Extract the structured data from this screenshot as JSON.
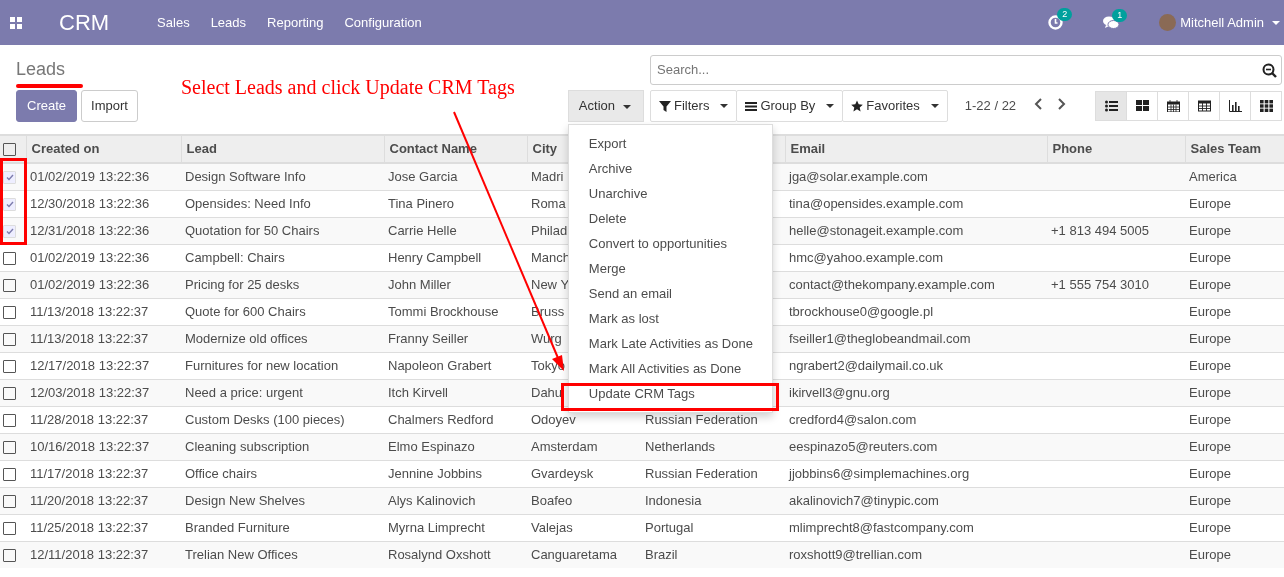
{
  "navbar": {
    "app": "CRM",
    "menu": [
      "Sales",
      "Leads",
      "Reporting",
      "Configuration"
    ],
    "activity_count": "2",
    "message_count": "1",
    "user": "Mitchell Admin"
  },
  "breadcrumb": "Leads",
  "buttons": {
    "create": "Create",
    "import": "Import",
    "action": "Action"
  },
  "search": {
    "placeholder": "Search..."
  },
  "search_options": [
    {
      "kind": "filter",
      "label": "Filters"
    },
    {
      "kind": "group",
      "label": "Group By"
    },
    {
      "kind": "favorite",
      "label": "Favorites"
    }
  ],
  "pager": "1-22 / 22",
  "views": [
    {
      "kind": "list",
      "selected": true
    },
    {
      "kind": "kanban",
      "selected": false
    },
    {
      "kind": "calendar",
      "selected": false
    },
    {
      "kind": "pivot",
      "selected": false
    },
    {
      "kind": "graph",
      "selected": false
    },
    {
      "kind": "dashboard",
      "selected": false
    }
  ],
  "action_menu": {
    "items": [
      "Export",
      "Archive",
      "Unarchive",
      "Delete",
      "Convert to opportunities",
      "Merge",
      "Send an email",
      "Mark as lost",
      "Mark Late Activities as Done",
      "Mark All Activities as Done",
      "Update CRM Tags"
    ]
  },
  "table": {
    "all_selected": false,
    "columns": [
      "Created on",
      "Lead",
      "Contact Name",
      "City",
      null,
      "Email",
      "Phone",
      "Sales Team"
    ],
    "rows": [
      {
        "selected": true,
        "cells": [
          "01/02/2019 13:22:36",
          "Design Software Info",
          "Jose Garcia",
          "Madri",
          null,
          "jga@solar.example.com",
          null,
          "America"
        ]
      },
      {
        "selected": true,
        "cells": [
          "12/30/2018 13:22:36",
          "Opensides: Need Info",
          "Tina Pinero",
          "Roma",
          null,
          "tina@opensides.example.com",
          null,
          "Europe"
        ]
      },
      {
        "selected": true,
        "cells": [
          "12/31/2018 13:22:36",
          "Quotation for 50 Chairs",
          "Carrie Helle",
          "Philad",
          null,
          "helle@stonageit.example.com",
          "+1 813 494 5005",
          "Europe"
        ]
      },
      {
        "selected": false,
        "cells": [
          "01/02/2019 13:22:36",
          "Campbell: Chairs",
          "Henry Campbell",
          "Manch",
          null,
          "hmc@yahoo.example.com",
          null,
          "Europe"
        ]
      },
      {
        "selected": false,
        "cells": [
          "01/02/2019 13:22:36",
          "Pricing for 25 desks",
          "John Miller",
          "New Y",
          null,
          "contact@thekompany.example.com",
          "+1 555 754 3010",
          "Europe"
        ]
      },
      {
        "selected": false,
        "cells": [
          "11/13/2018 13:22:37",
          "Quote for 600 Chairs",
          "Tommi Brockhouse",
          "Bruss",
          null,
          "tbrockhouse0@google.pl",
          null,
          "Europe"
        ]
      },
      {
        "selected": false,
        "cells": [
          "11/13/2018 13:22:37",
          "Modernize old offices",
          "Franny Seiller",
          "Wurg",
          null,
          "fseiller1@theglobeandmail.com",
          null,
          "Europe"
        ]
      },
      {
        "selected": false,
        "cells": [
          "12/17/2018 13:22:37",
          "Furnitures for new location",
          "Napoleon Grabert",
          "Tokyo",
          null,
          "ngrabert2@dailymail.co.uk",
          null,
          "Europe"
        ]
      },
      {
        "selected": false,
        "cells": [
          "12/03/2018 13:22:37",
          "Need a price: urgent",
          "Itch Kirvell",
          "Dahu",
          null,
          "ikirvell3@gnu.org",
          null,
          "Europe"
        ]
      },
      {
        "selected": false,
        "cells": [
          "11/28/2018 13:22:37",
          "Custom Desks (100 pieces)",
          "Chalmers Redford",
          "Odoyev",
          "Russian Federation",
          "credford4@salon.com",
          null,
          "Europe"
        ]
      },
      {
        "selected": false,
        "cells": [
          "10/16/2018 13:22:37",
          "Cleaning subscription",
          "Elmo Espinazo",
          "Amsterdam",
          "Netherlands",
          "eespinazo5@reuters.com",
          null,
          "Europe"
        ]
      },
      {
        "selected": false,
        "cells": [
          "11/17/2018 13:22:37",
          "Office chairs",
          "Jennine Jobbins",
          "Gvardeysk",
          "Russian Federation",
          "jjobbins6@simplemachines.org",
          null,
          "Europe"
        ]
      },
      {
        "selected": false,
        "cells": [
          "11/20/2018 13:22:37",
          "Design New Shelves",
          "Alys Kalinovich",
          "Boafeo",
          "Indonesia",
          "akalinovich7@tinypic.com",
          null,
          "Europe"
        ]
      },
      {
        "selected": false,
        "cells": [
          "11/25/2018 13:22:37",
          "Branded Furniture",
          "Myrna Limprecht",
          "Valejas",
          "Portugal",
          "mlimprecht8@fastcompany.com",
          null,
          "Europe"
        ]
      },
      {
        "selected": false,
        "cells": [
          "12/11/2018 13:22:37",
          "Trelian New Offices",
          "Rosalynd Oxshott",
          "Canguaretama",
          "Brazil",
          "roxshott9@trellian.com",
          null,
          "Europe"
        ]
      }
    ]
  },
  "annotation": {
    "text": "Select Leads and click Update CRM Tags"
  }
}
